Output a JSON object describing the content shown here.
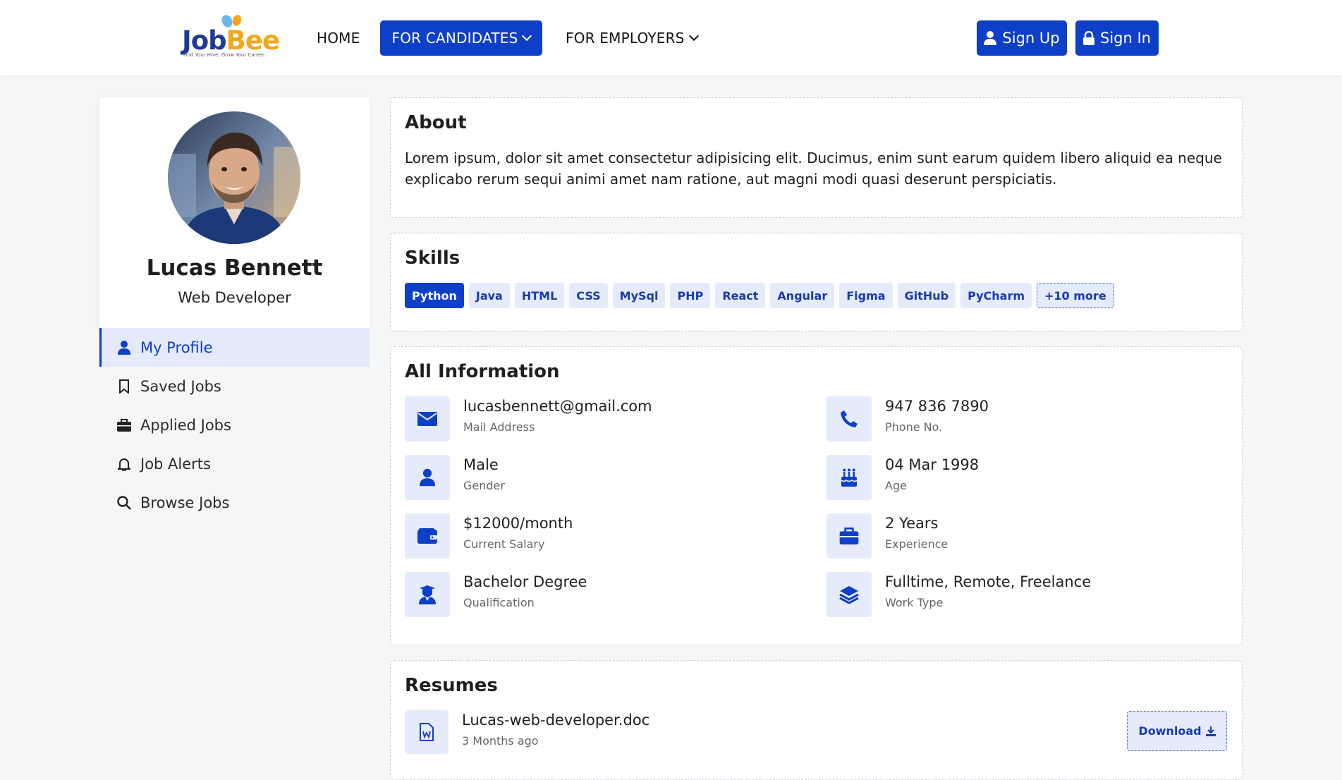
{
  "header": {
    "logo": {
      "part1": "Job",
      "part2": "Bee",
      "tagline": "Find Your Hive, Grow Your Career"
    },
    "nav": {
      "home": "HOME",
      "candidates": "FOR CANDIDATES",
      "employers": "FOR EMPLOYERS"
    },
    "signup": "Sign Up",
    "signin": "Sign In",
    "accent_color": "#0d3fc8"
  },
  "profile": {
    "name": "Lucas Bennett",
    "role": "Web Developer"
  },
  "sidebar": {
    "items": [
      {
        "label": "My Profile",
        "icon": "user-icon",
        "active": true
      },
      {
        "label": "Saved Jobs",
        "icon": "bookmark-icon",
        "active": false
      },
      {
        "label": "Applied Jobs",
        "icon": "briefcase-icon",
        "active": false
      },
      {
        "label": "Job Alerts",
        "icon": "bell-icon",
        "active": false
      },
      {
        "label": "Browse Jobs",
        "icon": "search-icon",
        "active": false
      }
    ]
  },
  "about": {
    "title": "About",
    "text": "Lorem ipsum, dolor sit amet consectetur adipisicing elit. Ducimus, enim sunt earum quidem libero aliquid ea neque explicabo rerum sequi animi amet nam ratione, aut magni modi quasi deserunt perspiciatis."
  },
  "skills": {
    "title": "Skills",
    "items": [
      "Python",
      "Java",
      "HTML",
      "CSS",
      "MySql",
      "PHP",
      "React",
      "Angular",
      "Figma",
      "GitHub",
      "PyCharm"
    ],
    "more": "+10 more"
  },
  "info": {
    "title": "All Information",
    "items": [
      {
        "value": "lucasbennett@gmail.com",
        "label": "Mail Address",
        "icon": "envelope-icon"
      },
      {
        "value": "947 836 7890",
        "label": "Phone No.",
        "icon": "phone-icon"
      },
      {
        "value": "Male",
        "label": "Gender",
        "icon": "user-icon"
      },
      {
        "value": "04 Mar 1998",
        "label": "Age",
        "icon": "birthday-cake-icon"
      },
      {
        "value": "$12000/month",
        "label": "Current Salary",
        "icon": "wallet-icon"
      },
      {
        "value": "2 Years",
        "label": "Experience",
        "icon": "briefcase-icon"
      },
      {
        "value": "Bachelor Degree",
        "label": "Qualification",
        "icon": "graduate-icon"
      },
      {
        "value": "Fulltime, Remote, Freelance",
        "label": "Work Type",
        "icon": "layers-icon"
      }
    ]
  },
  "resumes": {
    "title": "Resumes",
    "files": [
      {
        "name": "Lucas-web-developer.doc",
        "date": "3 Months ago",
        "icon": "word-file-icon"
      }
    ],
    "download": "Download"
  }
}
